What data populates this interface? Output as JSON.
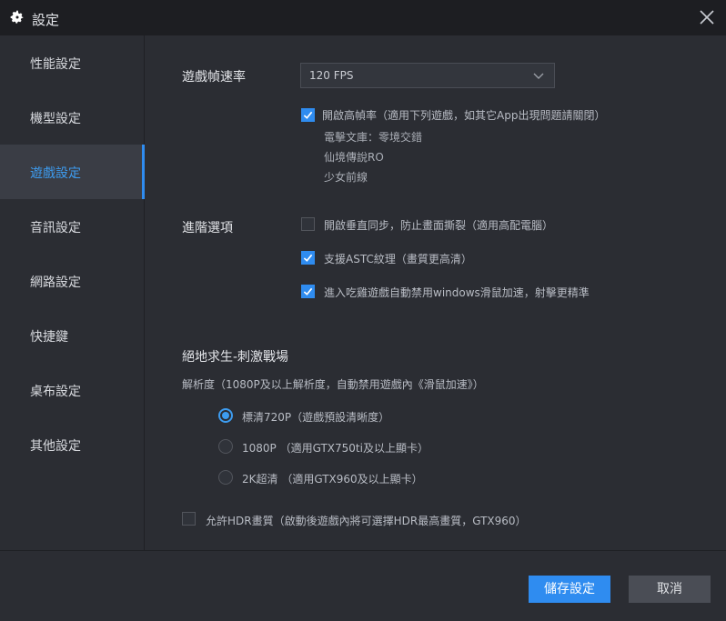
{
  "window": {
    "title": "設定",
    "icon": "gear-icon"
  },
  "sidebar": {
    "items": [
      {
        "label": "性能設定",
        "active": false
      },
      {
        "label": "機型設定",
        "active": false
      },
      {
        "label": "遊戲設定",
        "active": true
      },
      {
        "label": "音訊設定",
        "active": false
      },
      {
        "label": "網路設定",
        "active": false
      },
      {
        "label": "快捷鍵",
        "active": false
      },
      {
        "label": "桌布設定",
        "active": false
      },
      {
        "label": "其他設定",
        "active": false
      }
    ]
  },
  "game": {
    "fps_label": "遊戲幀速率",
    "fps_value": "120 FPS",
    "high_fps": {
      "label": "開啟高幀率（適用下列遊戲，如其它App出現問題請關閉）",
      "checked": true,
      "games": [
        "電擊文庫：零境交錯",
        "仙境傳說RO",
        "少女前線"
      ]
    },
    "advanced_label": "進階選項",
    "advanced_options": [
      {
        "label": "開啟垂直同步，防止畫面撕裂（適用高配電腦）",
        "checked": false
      },
      {
        "label": "支援ASTC紋理（畫質更高清）",
        "checked": true
      },
      {
        "label": "進入吃雞遊戲自動禁用windows滑鼠加速，射擊更精準",
        "checked": true
      }
    ],
    "pubg": {
      "title": "絕地求生-刺激戰場",
      "resolution_hint": "解析度（1080P及以上解析度，自動禁用遊戲內《滑鼠加速》）",
      "resolutions": [
        {
          "label": "標清720P（遊戲預設清晰度）",
          "selected": true
        },
        {
          "label": "1080P （適用GTX750ti及以上顯卡）",
          "selected": false
        },
        {
          "label": "2K超清 （適用GTX960及以上顯卡）",
          "selected": false
        }
      ],
      "hdr": {
        "label": "允許HDR畫質（啟動後遊戲內將可選擇HDR最高畫質，GTX960）",
        "checked": false
      }
    }
  },
  "footer": {
    "save_label": "儲存設定",
    "cancel_label": "取消"
  },
  "colors": {
    "accent": "#2f8cf0",
    "background": "#2b2d33",
    "titlebar": "#1d1e22"
  }
}
